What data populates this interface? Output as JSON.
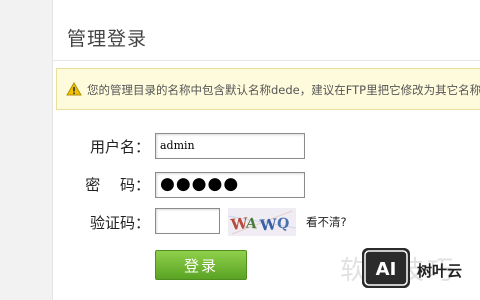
{
  "page": {
    "title": "管理登录"
  },
  "warning": {
    "icon": "warning-icon",
    "text": "您的管理目录的名称中包含默认名称dede，建议在FTP里把它修改为其它名称"
  },
  "form": {
    "username": {
      "label": "用户名：",
      "value": "admin"
    },
    "password": {
      "label": "密　 码：",
      "value": "●●●●●"
    },
    "captcha": {
      "label": "验证码：",
      "value": "",
      "image_text": "WAWQ",
      "refresh_text": "看不清?"
    },
    "submit_label": "登录"
  },
  "watermark": {
    "bg_text": "软件技巧",
    "logo_text": "AI",
    "name": "树叶云"
  }
}
